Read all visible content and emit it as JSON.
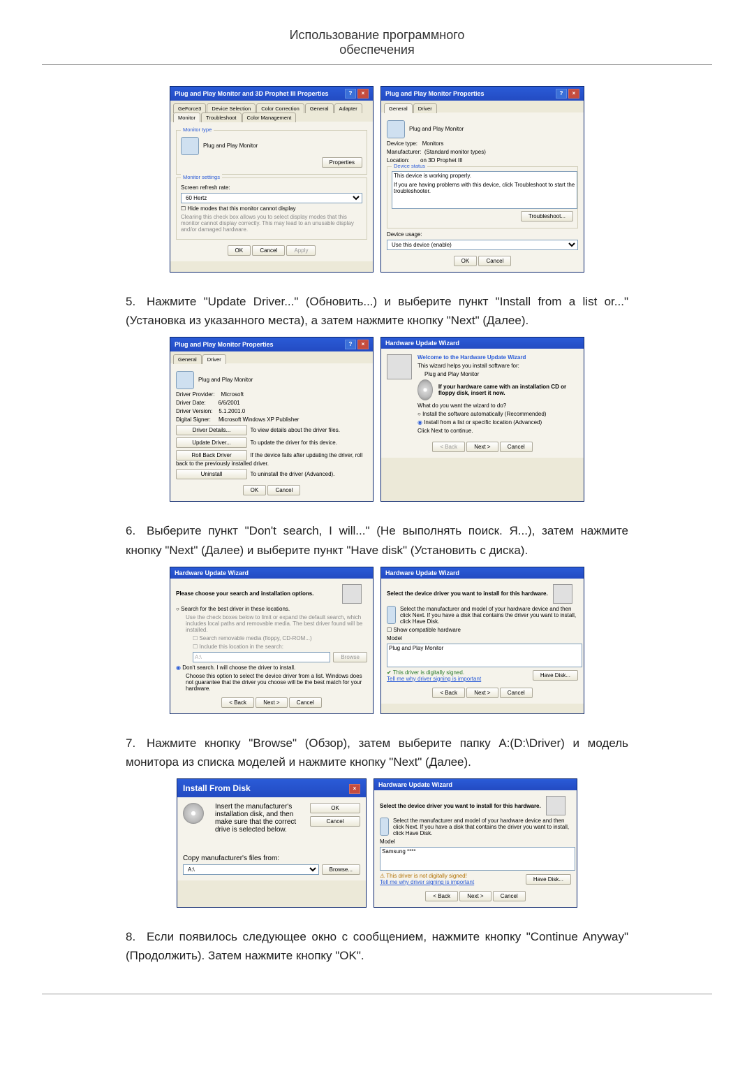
{
  "header": {
    "line1": "Использование программного",
    "line2": "обеспечения"
  },
  "step5": "Нажмите \"Update Driver...\" (Обновить...) и выберите пункт \"Install from a list or...\" (Установка из указанного места), а затем нажмите кнопку \"Next\" (Далее).",
  "step6": "Выберите пункт \"Don't search, I will...\" (Не выполнять поиск. Я...), затем нажмите кнопку \"Next\" (Далее) и выберите пункт \"Have disk\" (Установить с диска).",
  "step7": "Нажмите кнопку \"Browse\" (Обзор), затем выберите папку A:(D:\\Driver) и модель монитора из списка моделей и нажмите кнопку \"Next\" (Далее).",
  "step8": "Если появилось следующее окно с сообщением, нажмите кнопку \"Continue Anyway\" (Продолжить). Затем нажмите кнопку \"OK\".",
  "dlg1": {
    "title": "Plug and Play Monitor and 3D Prophet III Properties",
    "tabs": [
      "GeForce3",
      "Device Selection",
      "Color Correction",
      "General",
      "Adapter",
      "Monitor",
      "Troubleshoot",
      "Color Management"
    ],
    "monitorType": "Monitor type",
    "monitorName": "Plug and Play Monitor",
    "propertiesBtn": "Properties",
    "monitorSettings": "Monitor settings",
    "refreshLabel": "Screen refresh rate:",
    "refreshValue": "60 Hertz",
    "hideModes": "Hide modes that this monitor cannot display",
    "clearNote": "Clearing this check box allows you to select display modes that this monitor cannot display correctly. This may lead to an unusable display and/or damaged hardware.",
    "ok": "OK",
    "cancel": "Cancel",
    "apply": "Apply"
  },
  "dlg2": {
    "title": "Plug and Play Monitor Properties",
    "tabs": [
      "General",
      "Driver"
    ],
    "name": "Plug and Play Monitor",
    "devType": "Device type:",
    "devTypeVal": "Monitors",
    "manu": "Manufacturer:",
    "manuVal": "(Standard monitor types)",
    "loc": "Location:",
    "locVal": "on 3D Prophet III",
    "status": "Device status",
    "statusText": "This device is working properly.",
    "statusHelp": "If you are having problems with this device, click Troubleshoot to start the troubleshooter.",
    "troubleshoot": "Troubleshoot...",
    "usage": "Device usage:",
    "usageVal": "Use this device (enable)",
    "ok": "OK",
    "cancel": "Cancel"
  },
  "dlg3": {
    "title": "Plug and Play Monitor Properties",
    "tabs": [
      "General",
      "Driver"
    ],
    "name": "Plug and Play Monitor",
    "provider": "Driver Provider:",
    "providerVal": "Microsoft",
    "date": "Driver Date:",
    "dateVal": "6/6/2001",
    "version": "Driver Version:",
    "versionVal": "5.1.2001.0",
    "signer": "Digital Signer:",
    "signerVal": "Microsoft Windows XP Publisher",
    "details": "Driver Details...",
    "detailsDesc": "To view details about the driver files.",
    "update": "Update Driver...",
    "updateDesc": "To update the driver for this device.",
    "rollback": "Roll Back Driver",
    "rollbackDesc": "If the device fails after updating the driver, roll back to the previously installed driver.",
    "uninstall": "Uninstall",
    "uninstallDesc": "To uninstall the driver (Advanced).",
    "ok": "OK",
    "cancel": "Cancel"
  },
  "dlg4": {
    "title": "Hardware Update Wizard",
    "welcome": "Welcome to the Hardware Update Wizard",
    "helps": "This wizard helps you install software for:",
    "device": "Plug and Play Monitor",
    "cdNote": "If your hardware came with an installation CD or floppy disk, insert it now.",
    "what": "What do you want the wizard to do?",
    "opt1": "Install the software automatically (Recommended)",
    "opt2": "Install from a list or specific location (Advanced)",
    "clickNext": "Click Next to continue.",
    "back": "< Back",
    "next": "Next >",
    "cancel": "Cancel"
  },
  "dlg5": {
    "title": "Hardware Update Wizard",
    "heading": "Please choose your search and installation options.",
    "opt1": "Search for the best driver in these locations.",
    "opt1desc": "Use the check boxes below to limit or expand the default search, which includes local paths and removable media. The best driver found will be installed.",
    "chk1": "Search removable media (floppy, CD-ROM...)",
    "chk2": "Include this location in the search:",
    "loc": "A:\\",
    "browse": "Browse",
    "opt2": "Don't search. I will choose the driver to install.",
    "opt2desc": "Choose this option to select the device driver from a list. Windows does not guarantee that the driver you choose will be the best match for your hardware.",
    "back": "< Back",
    "next": "Next >",
    "cancel": "Cancel"
  },
  "dlg6": {
    "title": "Hardware Update Wizard",
    "heading": "Select the device driver you want to install for this hardware.",
    "note": "Select the manufacturer and model of your hardware device and then click Next. If you have a disk that contains the driver you want to install, click Have Disk.",
    "chk": "Show compatible hardware",
    "modelLbl": "Model",
    "model": "Plug and Play Monitor",
    "signed": "This driver is digitally signed.",
    "tell": "Tell me why driver signing is important",
    "have": "Have Disk...",
    "back": "< Back",
    "next": "Next >",
    "cancel": "Cancel"
  },
  "dlg7": {
    "title": "Install From Disk",
    "msg": "Insert the manufacturer's installation disk, and then make sure that the correct drive is selected below.",
    "ok": "OK",
    "cancel": "Cancel",
    "copy": "Copy manufacturer's files from:",
    "path": "A:\\",
    "browse": "Browse..."
  },
  "dlg8": {
    "title": "Hardware Update Wizard",
    "heading": "Select the device driver you want to install for this hardware.",
    "note": "Select the manufacturer and model of your hardware device and then click Next. If you have a disk that contains the driver you want to install, click Have Disk.",
    "modelLbl": "Model",
    "model": "Samsung ****",
    "notSigned": "This driver is not digitally signed!",
    "tell": "Tell me why driver signing is important",
    "have": "Have Disk...",
    "back": "< Back",
    "next": "Next >",
    "cancel": "Cancel"
  }
}
